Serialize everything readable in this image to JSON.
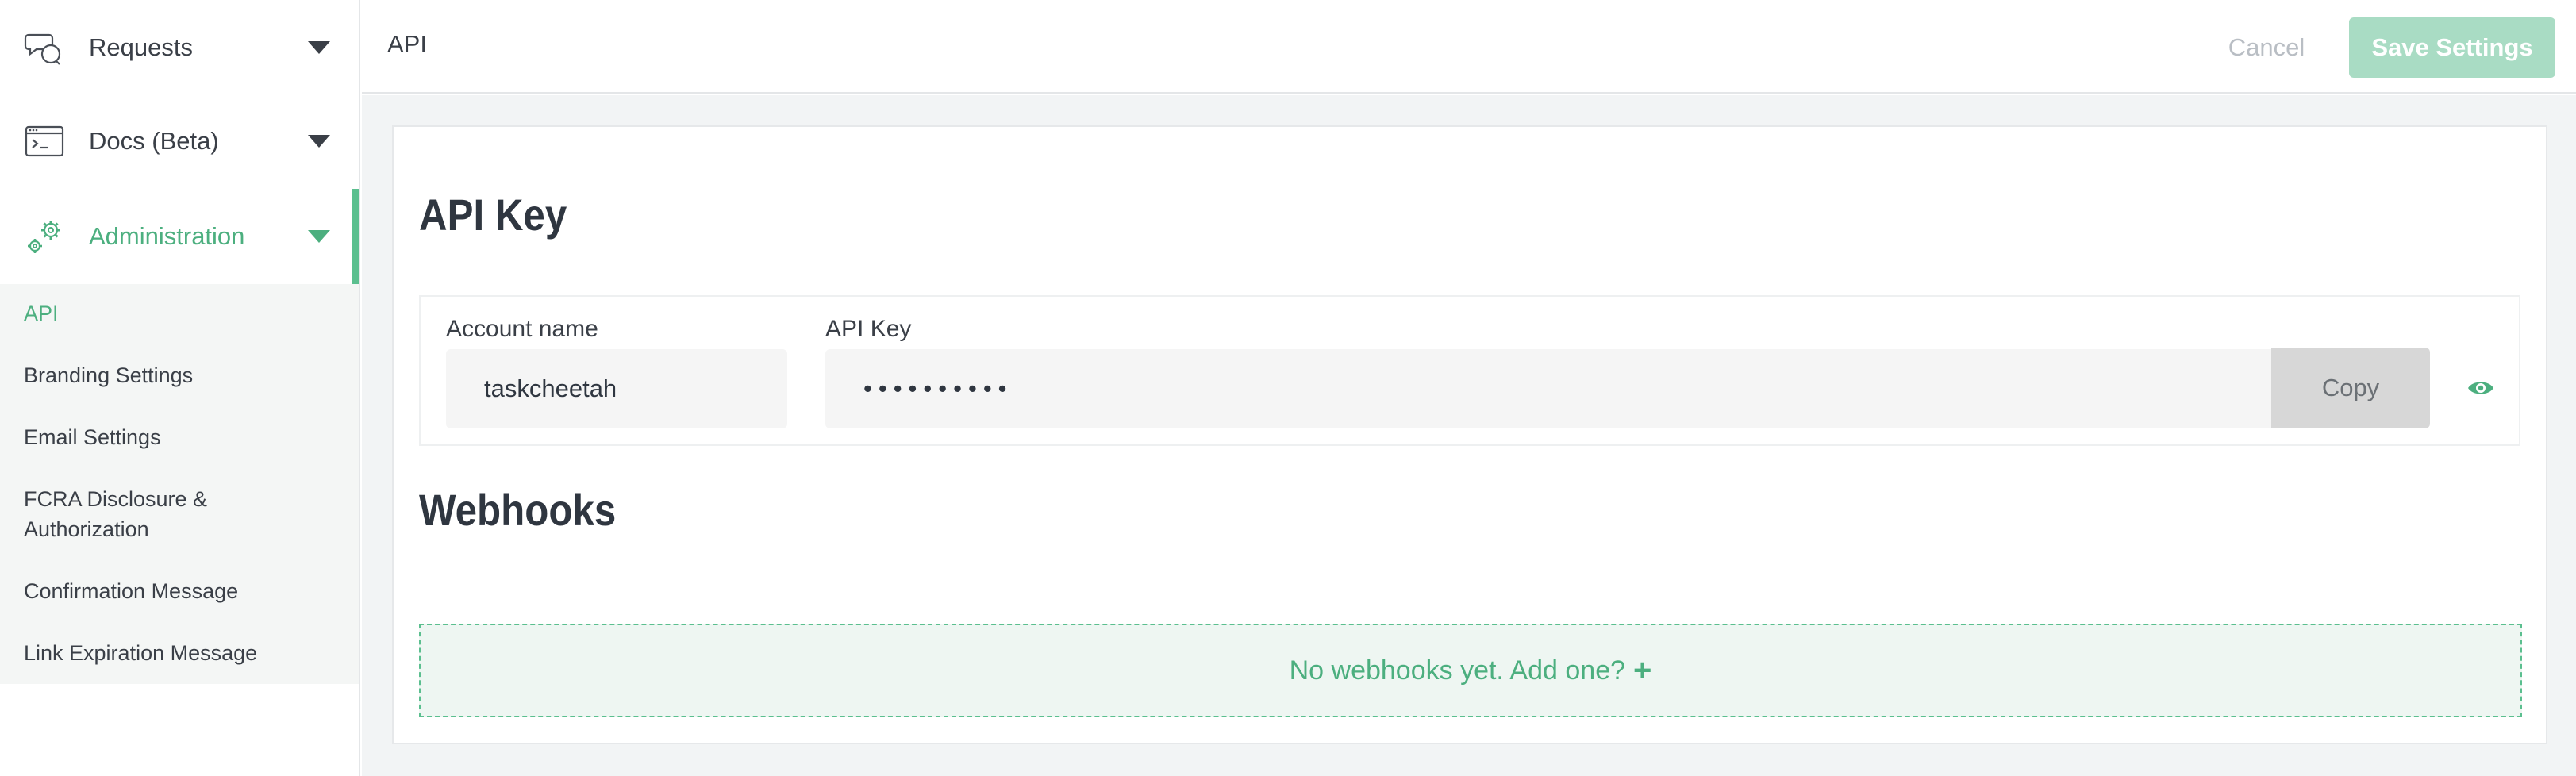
{
  "sidebar": {
    "items": [
      {
        "label": "Requests",
        "icon": "chat-bubbles-icon"
      },
      {
        "label": "Docs (Beta)",
        "icon": "terminal-window-icon"
      },
      {
        "label": "Administration",
        "icon": "gears-icon"
      }
    ],
    "submenu": [
      {
        "label": "API"
      },
      {
        "label": "Branding Settings"
      },
      {
        "label": "Email Settings"
      },
      {
        "label": "FCRA Disclosure & Authorization"
      },
      {
        "label": "Confirmation Message"
      },
      {
        "label": "Link Expiration Message"
      }
    ]
  },
  "header": {
    "title": "API",
    "cancel_label": "Cancel",
    "save_label": "Save Settings"
  },
  "api_key_section": {
    "heading": "API Key",
    "account_label": "Account name",
    "account_value": "taskcheetah",
    "key_label": "API Key",
    "key_value": "••••••••••",
    "copy_label": "Copy"
  },
  "webhooks_section": {
    "heading": "Webhooks",
    "empty_text": "No webhooks yet. Add one?",
    "add_icon": "+"
  },
  "colors": {
    "accent": "#4caf7f",
    "accent_light": "#a9dcc4",
    "text": "#3a3f47",
    "muted": "#b9bec4"
  }
}
